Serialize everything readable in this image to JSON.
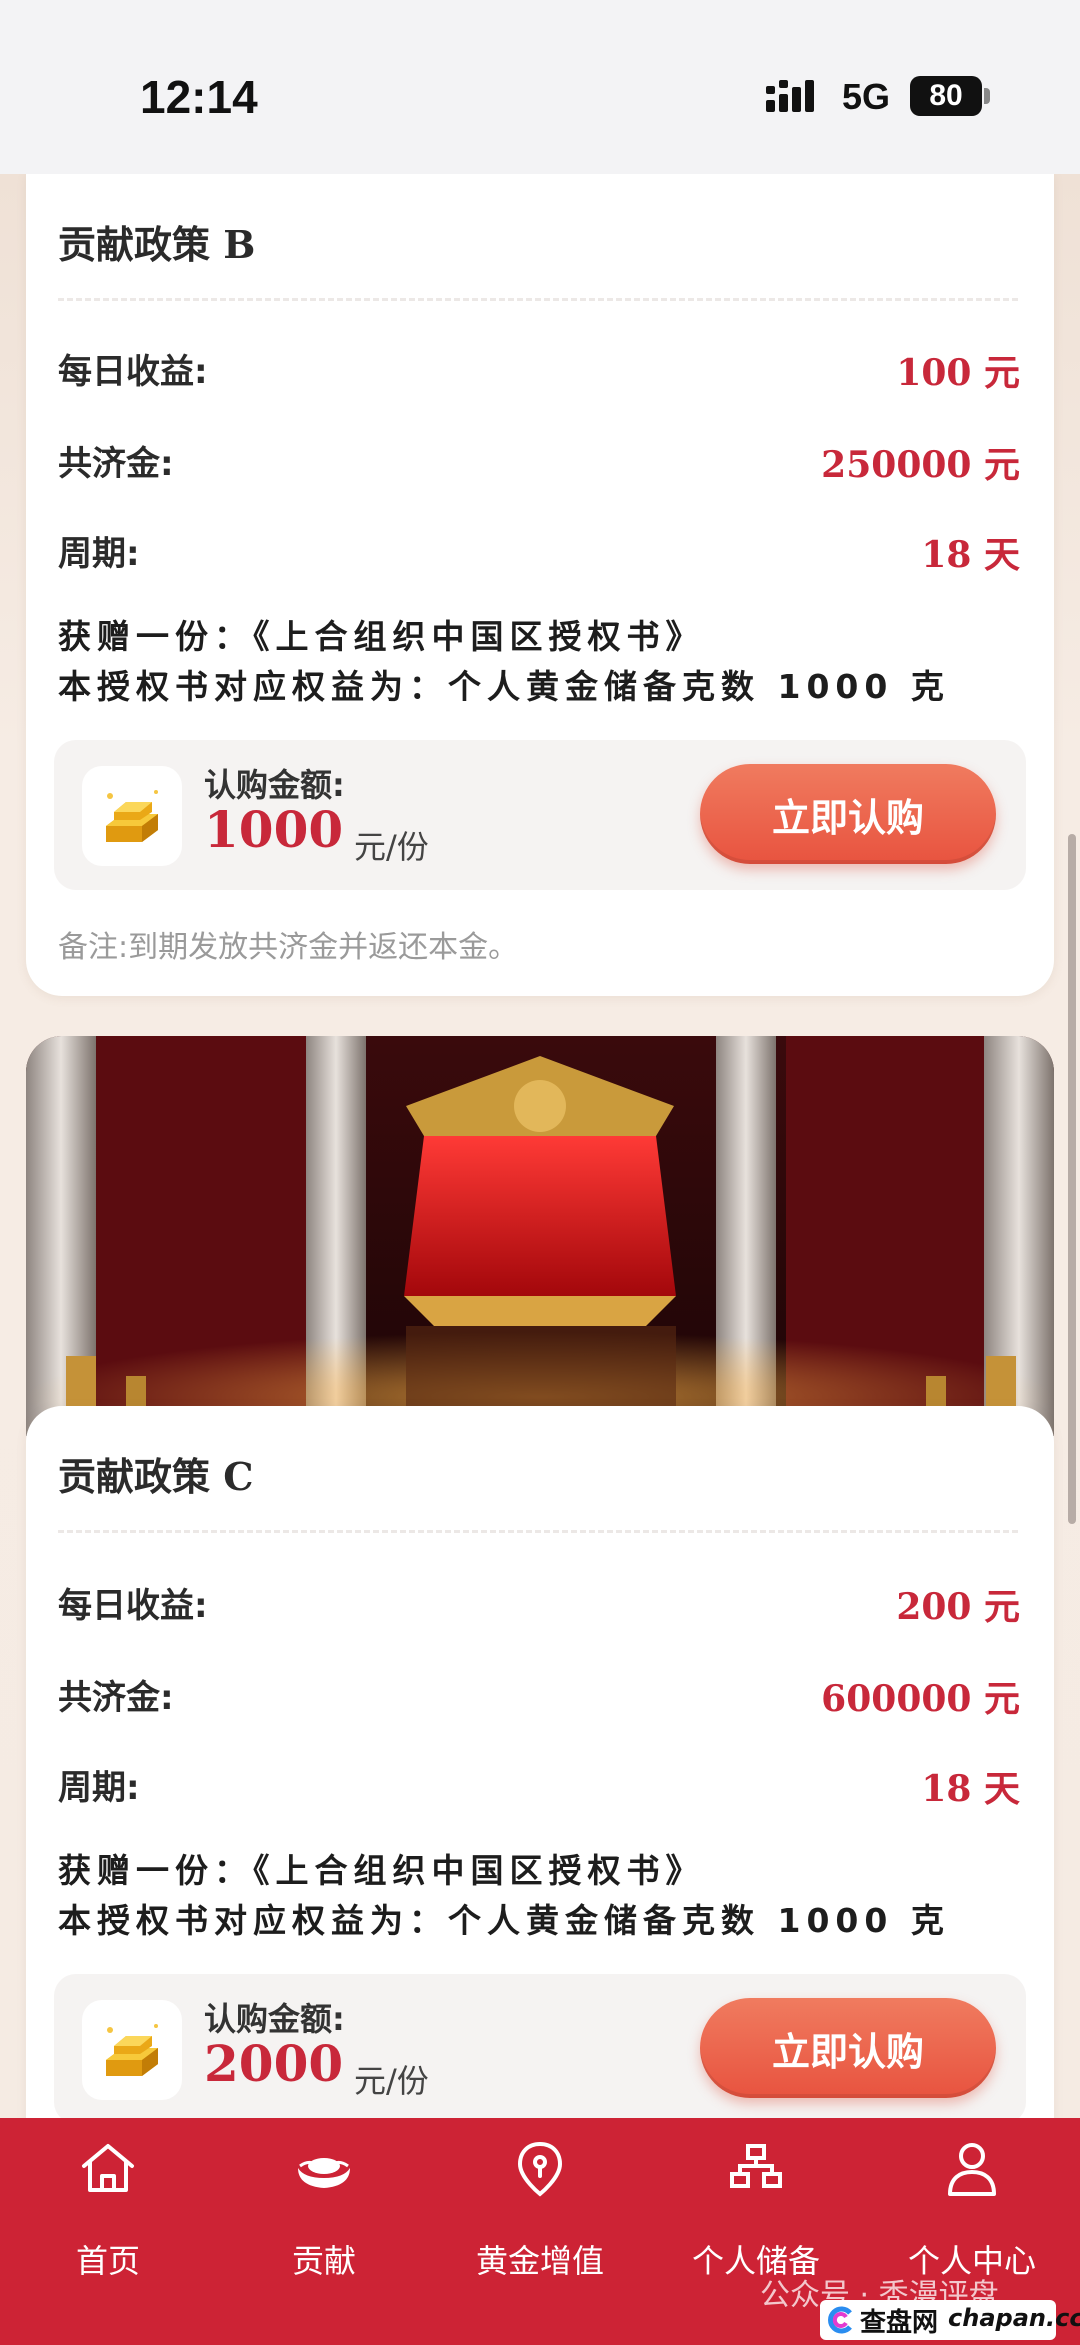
{
  "status_bar": {
    "time": "12:14",
    "network": "5G",
    "battery": "80"
  },
  "policies": [
    {
      "title": "贡献政策 B",
      "daily_income_label": "每日收益:",
      "daily_income_value": "100 元",
      "fund_label": "共济金:",
      "fund_value": "250000 元",
      "period_label": "周期:",
      "period_value": "18 天",
      "gift_line_1": "获赠一份：《上合组织中国区授权书》",
      "gift_line_2": "本授权书对应权益为：个人黄金储备克数 1000 克",
      "buy_label": "认购金额:",
      "buy_amount": "1000",
      "buy_unit": "元/份",
      "buy_button": "立即认购",
      "note": "备注:到期发放共济金并返还本金。"
    },
    {
      "title": "贡献政策 C",
      "daily_income_label": "每日收益:",
      "daily_income_value": "200 元",
      "fund_label": "共济金:",
      "fund_value": "600000 元",
      "period_label": "周期:",
      "period_value": "18 天",
      "gift_line_1": "获赠一份：《上合组织中国区授权书》",
      "gift_line_2": "本授权书对应权益为：个人黄金储备克数 1000 克",
      "buy_label": "认购金额:",
      "buy_amount": "2000",
      "buy_unit": "元/份",
      "buy_button": "立即认购"
    }
  ],
  "nav": [
    {
      "label": "首页",
      "icon": "home-icon"
    },
    {
      "label": "贡献",
      "icon": "gold-ingot-icon"
    },
    {
      "label": "黄金增值",
      "icon": "location-pin-icon"
    },
    {
      "label": "个人储备",
      "icon": "hierarchy-icon"
    },
    {
      "label": "个人中心",
      "icon": "user-icon"
    }
  ],
  "watermark": {
    "text": "公众号 · 秃漫评盘",
    "logo_text": "查盘网",
    "logo_domain": "chapan.cc"
  },
  "colors": {
    "accent_red": "#c8283a",
    "nav_red": "#cd2335",
    "button_orange": "#e8533f"
  }
}
